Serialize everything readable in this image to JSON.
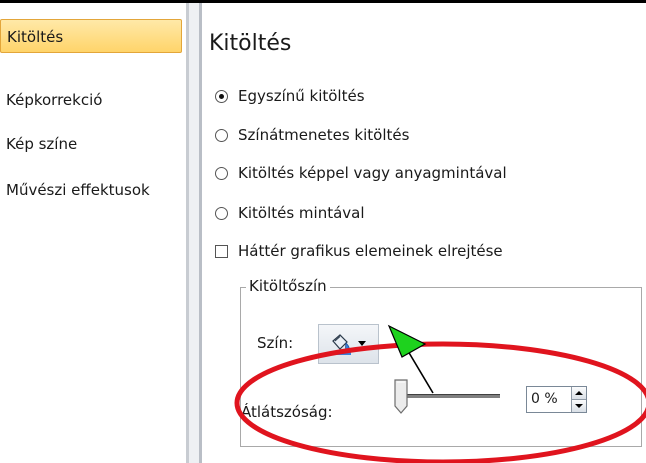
{
  "sidebar": {
    "items": [
      {
        "label": "Kitöltés",
        "selected": true
      },
      {
        "label": "Képkorrekció",
        "selected": false
      },
      {
        "label": "Kép színe",
        "selected": false
      },
      {
        "label": "Művészi effektusok",
        "selected": false
      }
    ]
  },
  "panel": {
    "title": "Kitöltés",
    "options": [
      {
        "label": "Egyszínű kitöltés",
        "checked": true
      },
      {
        "label": "Színátmenetes kitöltés",
        "checked": false
      },
      {
        "label": "Kitöltés képpel vagy anyagmintával",
        "checked": false
      },
      {
        "label": "Kitöltés mintával",
        "checked": false
      }
    ],
    "hide_background_label": "Háttér grafikus elemeinek elrejtése",
    "hide_background_checked": false,
    "fill_color_group": {
      "legend": "Kitöltőszín",
      "color_label": "Szín:",
      "color_icon": "paint-bucket-icon",
      "transparency_label": "Átlátszóság:",
      "transparency_value": "0 %",
      "transparency_fraction": 0
    }
  },
  "annotations": {
    "ellipse_color": "#e0141e",
    "arrow_color": "#1ed21e"
  },
  "colors": {
    "selected_item_bg": "#ffd46a",
    "bucket_paint": "#3a7fd9"
  }
}
